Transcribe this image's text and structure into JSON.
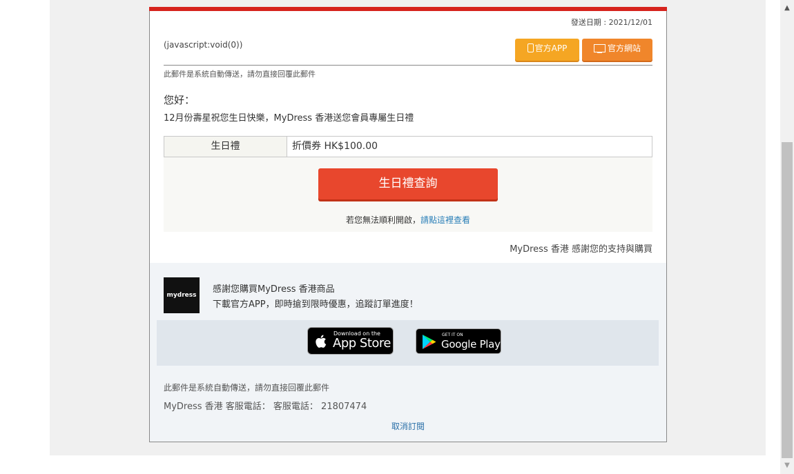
{
  "header": {
    "send_date": "發送日期 : 2021/12/01",
    "js_link": "(javascript:void(0))",
    "app_button": "官方APP",
    "web_button": "官方網站"
  },
  "notice": "此郵件是系統自動傳送，請勿直接回覆此郵件",
  "greeting": "您好：",
  "birthday_message": "12月份壽星祝您生日快樂，MyDress 香港送您會員專屬生日禮",
  "gift_table": {
    "label": "生日禮",
    "value": "折價券 HK$100.00"
  },
  "query_button": "生日禮查詢",
  "fallback": {
    "text": "若您無法順利開啟，",
    "link": "請點這裡查看"
  },
  "thanks": "MyDress 香港 感謝您的支持與購買",
  "footer": {
    "logo_text": "mydress",
    "promo_line1": "感謝您購買MyDress 香港商品",
    "promo_line2": "下載官方APP，即時搶到限時優惠，追蹤訂單進度！",
    "app_store_small": "Download on the",
    "app_store_big": "App Store",
    "google_play_small": "GET IT ON",
    "google_play_big": "Google Play",
    "note": "此郵件是系統自動傳送，請勿直接回覆此郵件",
    "phone": "MyDress 香港 客服電話： 客服電話： 21807474",
    "unsubscribe": "取消訂閱"
  },
  "colors": {
    "brand_red": "#d6231d",
    "button_orange": "#f5a623",
    "query_red": "#e8472d",
    "link_blue": "#2a7fb8"
  },
  "scrollbar": {
    "up_icon": "▲",
    "down_icon": "▼"
  }
}
